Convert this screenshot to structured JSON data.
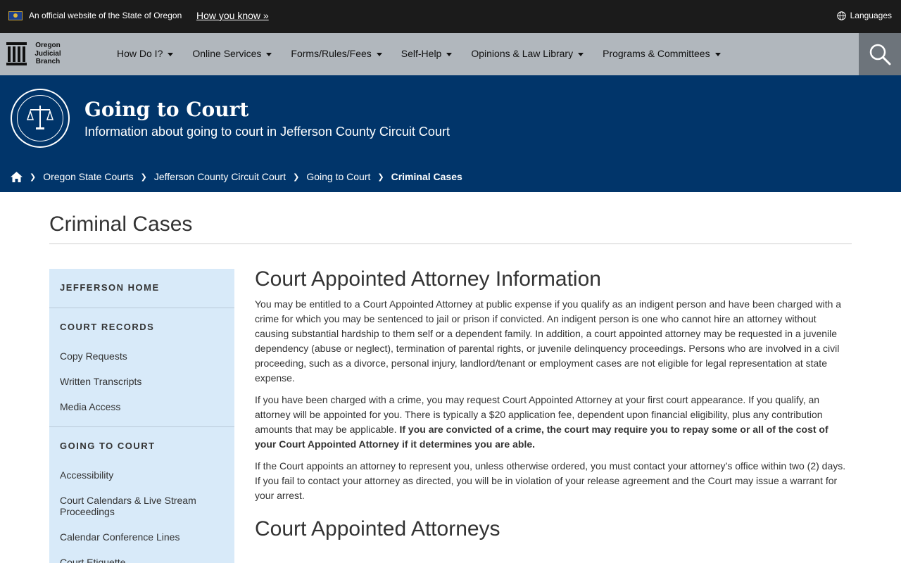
{
  "official_banner": {
    "text": "An official website of the State of Oregon",
    "how_link": "How you know »",
    "languages": "Languages"
  },
  "logo": {
    "line1": "Oregon",
    "line2": "Judicial",
    "line3": "Branch"
  },
  "nav": {
    "items": [
      {
        "label": "How Do I?"
      },
      {
        "label": "Online Services"
      },
      {
        "label": "Forms/Rules/Fees"
      },
      {
        "label": "Self-Help"
      },
      {
        "label": "Opinions & Law Library"
      },
      {
        "label": "Programs & Committees"
      }
    ]
  },
  "hero": {
    "title": "Going to Court",
    "subtitle": "Information about going to court in Jefferson County Circuit Court"
  },
  "breadcrumb": [
    {
      "label": "Oregon State Courts"
    },
    {
      "label": "Jefferson County Circuit Court"
    },
    {
      "label": "Going to Court"
    },
    {
      "label": "Criminal Cases"
    }
  ],
  "page_title": "Criminal Cases",
  "sidebar": {
    "home": "JEFFERSON HOME",
    "records_head": "COURT RECORDS",
    "records_items": [
      "Copy Requests",
      "Written Transcripts",
      "Media Access"
    ],
    "going_head": "GOING TO COURT",
    "going_items": [
      "Accessibility",
      "Court Calendars & Live Stream Proceedings",
      "Calendar Conference Lines",
      "Court Etiquette"
    ]
  },
  "main": {
    "heading1": "Court Appointed Attorney Information",
    "p1": "You may be entitled to a Court Appointed Attorney at public expense if you qualify as an indigent person and have been charged with a crime for which you may be sentenced to jail or prison if convicted. An indigent person is one who cannot hire an attorney without causing substantial hardship to them self or a dependent family. In addition, a court appointed attorney may be requested in a juvenile dependency (abuse or neglect), termination of parental rights, or juvenile delinquency proceedings. Persons who are involved in a civil proceeding, such as a divorce, personal injury, landlord/tenant or employment cases are not eligible for legal representation at state expense.",
    "p2_plain": "If you have been charged with a crime, you may request Court Appointed Attorney at your first court appearance. If you qualify, an attorney will be appointed for you. There is typically a $20 application fee, dependent upon financial eligibility, plus any contribution amounts that may be applicable.",
    "p2_bold": "If you are convicted of a crime, the court may require you to repay some or all of the cost of your Court Appointed Attorney if it determines you are able.",
    "p3": "If the Court appoints an attorney to represent you, unless otherwise ordered, you must contact your attorney’s office within two (2) days. If you fail to contact your attorney as directed, you will be in violation of your release agreement and the Court may issue a warrant for your arrest.",
    "heading2": "Court Appointed Attorneys"
  }
}
